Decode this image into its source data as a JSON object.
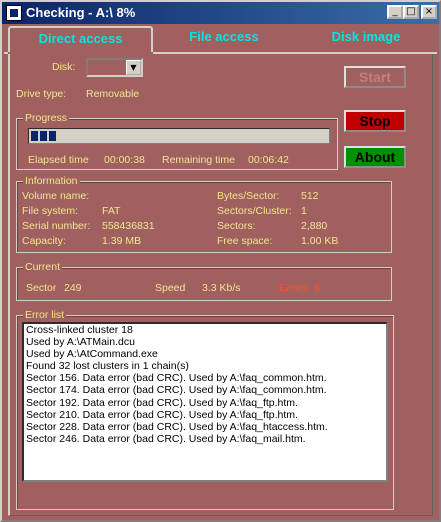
{
  "window": {
    "title": "Checking - A:\\ 8%",
    "icon": "app-icon",
    "controls": [
      "minimize-icon",
      "maximize-icon",
      "close-icon"
    ]
  },
  "tabs": [
    {
      "label": "Direct access",
      "active": true
    },
    {
      "label": "File access",
      "active": false
    },
    {
      "label": "Disk image",
      "active": false
    }
  ],
  "disk": {
    "label": "Disk:",
    "selected": "",
    "drive_type_label": "Drive type:",
    "drive_type_value": "Removable"
  },
  "buttons": {
    "start": "Start",
    "stop": "Stop",
    "about": "About"
  },
  "progress": {
    "caption": "Progress",
    "percent": 8,
    "elapsed_label": "Elapsed time",
    "elapsed_value": "00:00:38",
    "remaining_label": "Remaining time",
    "remaining_value": "00:06:42"
  },
  "information": {
    "caption": "Information",
    "left": [
      {
        "label": "Volume name:",
        "value": ""
      },
      {
        "label": "File system:",
        "value": "FAT"
      },
      {
        "label": "Serial number:",
        "value": "558436831"
      },
      {
        "label": "Capacity:",
        "value": "1.39 MB"
      }
    ],
    "right": [
      {
        "label": "Bytes/Sector:",
        "value": "512"
      },
      {
        "label": "Sectors/Cluster:",
        "value": "1"
      },
      {
        "label": "Sectors:",
        "value": "2,880"
      },
      {
        "label": "Free space:",
        "value": "1.00 KB"
      }
    ]
  },
  "current": {
    "caption": "Current",
    "sector_label": "Sector",
    "sector_value": "249",
    "speed_label": "Speed",
    "speed_value": "3.3 Kb/s",
    "errors_label": "Errors",
    "errors_value": "6"
  },
  "error_list": {
    "caption": "Error list",
    "lines": [
      "Cross-linked cluster 18",
      "Used by A:\\ATMain.dcu",
      "Used by A:\\AtCommand.exe",
      "Found 32 lost clusters in 1 chain(s)",
      "Sector 156. Data error (bad CRC). Used by A:\\faq_common.htm.",
      "Sector 174. Data error (bad CRC). Used by A:\\faq_common.htm.",
      "Sector 192. Data error (bad CRC). Used by A:\\faq_ftp.htm.",
      "Sector 210. Data error (bad CRC). Used by A:\\faq_ftp.htm.",
      "Sector 228. Data error (bad CRC). Used by A:\\faq_htaccess.htm.",
      "Sector 246. Data error (bad CRC). Used by A:\\faq_mail.htm."
    ]
  },
  "colors": {
    "background": "#a06060",
    "label_text": "#f0e68c",
    "tab_text": "#00e5e5",
    "start_text": "#c08080",
    "stop_bg": "#c00000",
    "about_bg": "#009000",
    "errors_text": "#ff5020",
    "progress_fill": "#0a246a"
  }
}
